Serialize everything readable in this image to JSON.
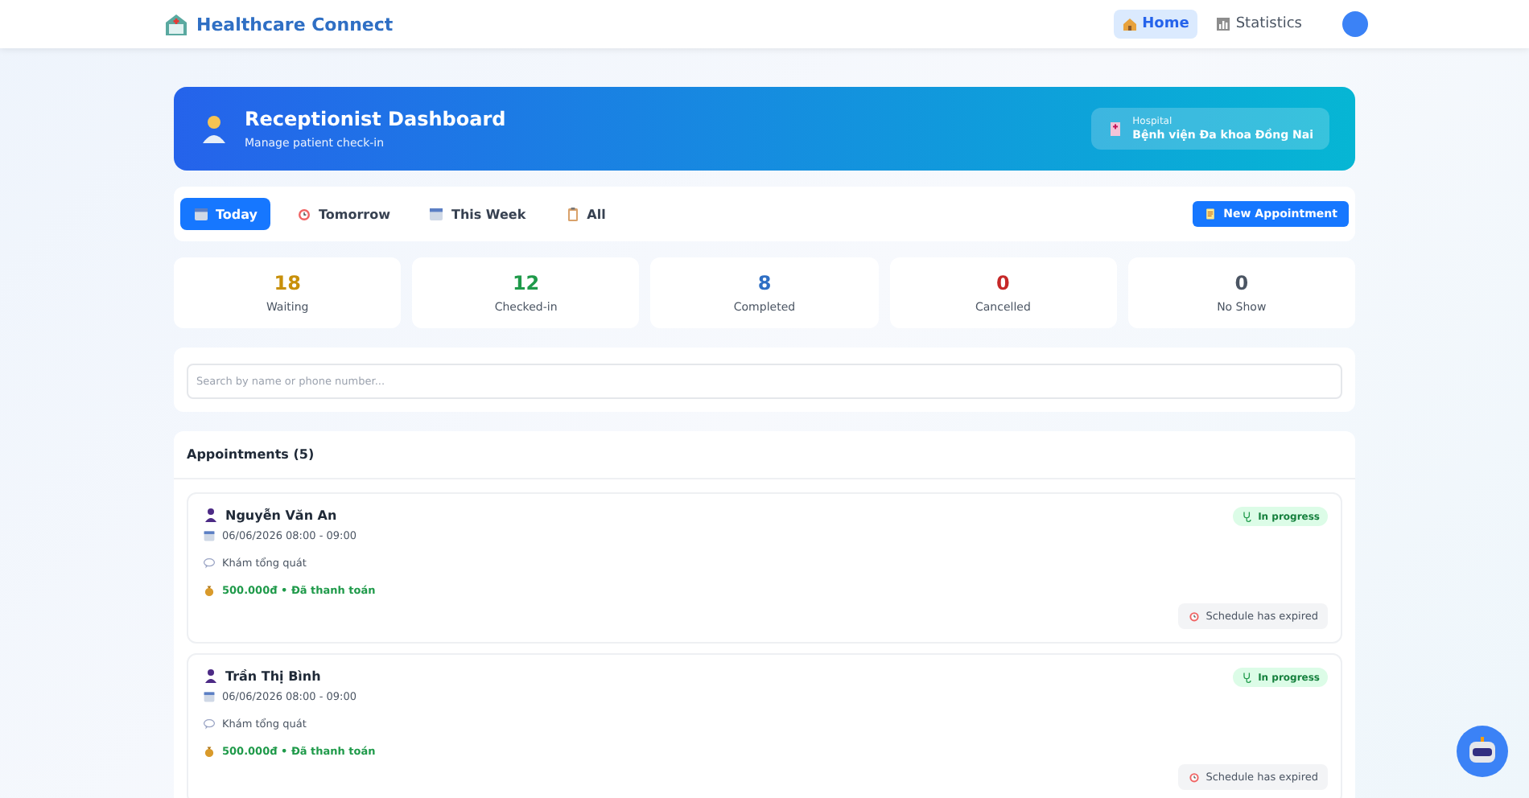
{
  "header": {
    "brand": "Healthcare Connect",
    "nav": [
      {
        "label": "Home",
        "selected": true
      },
      {
        "label": "Statistics",
        "selected": false
      }
    ]
  },
  "hero": {
    "title": "Receptionist Dashboard",
    "subtitle": "Manage patient check-in",
    "hospital_label": "Hospital",
    "hospital_name": "Bệnh viện Đa khoa Đồng Nai"
  },
  "tabs": [
    {
      "label": "Today",
      "selected": true
    },
    {
      "label": "Tomorrow",
      "selected": false
    },
    {
      "label": "This Week",
      "selected": false
    },
    {
      "label": "All",
      "selected": false
    }
  ],
  "new_button": "New Appointment",
  "stats": [
    {
      "value": "18",
      "label": "Waiting",
      "color": "#c8900a"
    },
    {
      "value": "12",
      "label": "Checked-in",
      "color": "#1f9a4a"
    },
    {
      "value": "8",
      "label": "Completed",
      "color": "#2f6fc4"
    },
    {
      "value": "0",
      "label": "Cancelled",
      "color": "#c62828"
    },
    {
      "value": "0",
      "label": "No Show",
      "color": "#4b5563"
    }
  ],
  "search": {
    "placeholder": "Search by name or phone number..."
  },
  "appointments": {
    "title": "Appointments (5)",
    "items": [
      {
        "name": "Nguyễn Văn An",
        "time": "06/06/2026 08:00 - 09:00",
        "service": "Khám tổng quát",
        "payment": "500.000đ • Đã thanh toán",
        "status": {
          "kind": "in_progress",
          "label": "In progress"
        },
        "note": "Schedule has expired"
      },
      {
        "name": "Trần Thị Bình",
        "time": "06/06/2026 08:00 - 09:00",
        "service": "Khám tổng quát",
        "payment": "500.000đ • Đã thanh toán",
        "status": {
          "kind": "in_progress",
          "label": "In progress"
        },
        "note": "Schedule has expired"
      }
    ]
  }
}
